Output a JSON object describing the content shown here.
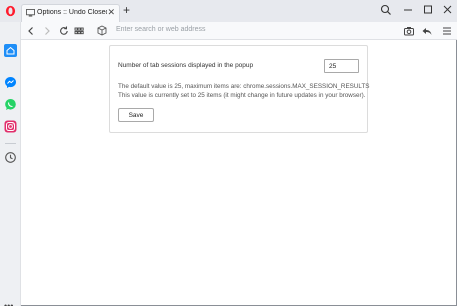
{
  "browser": {
    "tab": {
      "title": "Options :: Undo Closed Ta",
      "close_glyph": "✕"
    },
    "new_tab_glyph": "+",
    "address_placeholder": "Enter search or web address",
    "icons": {
      "logo": "opera-logo-icon",
      "favicon": "options-page-icon",
      "search": "search-icon",
      "minimize": "minimize-icon",
      "maximize": "maximize-icon",
      "close": "close-icon",
      "back": "back-arrow-icon",
      "forward": "forward-arrow-icon",
      "reload": "reload-icon",
      "speed_dial": "speed-dial-icon",
      "secure": "extension-cube-icon",
      "camera": "camera-icon",
      "reply": "reply-arrow-icon",
      "menu": "menu-lines-icon"
    },
    "colors": {
      "opera_red": "#ff1b2d",
      "home_blue": "#1e8ef7",
      "messenger_blue": "#0084ff",
      "whatsapp_green": "#25d366",
      "instagram_pink": "#e1306c"
    }
  },
  "sidebar": {
    "items": [
      {
        "name": "speed-dial-home",
        "icon": "home-icon"
      },
      {
        "name": "messenger",
        "icon": "messenger-icon"
      },
      {
        "name": "whatsapp",
        "icon": "whatsapp-icon"
      },
      {
        "name": "instagram",
        "icon": "instagram-icon"
      },
      {
        "name": "history",
        "icon": "clock-icon"
      }
    ],
    "more_glyph": "•••"
  },
  "options": {
    "label": "Number of tab sessions displayed in the popup",
    "value": "25",
    "description_line1": "The default value is 25, maximum items are: chrome.sessions.MAX_SESSION_RESULTS",
    "description_line2": "This value is currently set to 25 items (it might change in future updates in your browser).",
    "save_label": "Save"
  }
}
